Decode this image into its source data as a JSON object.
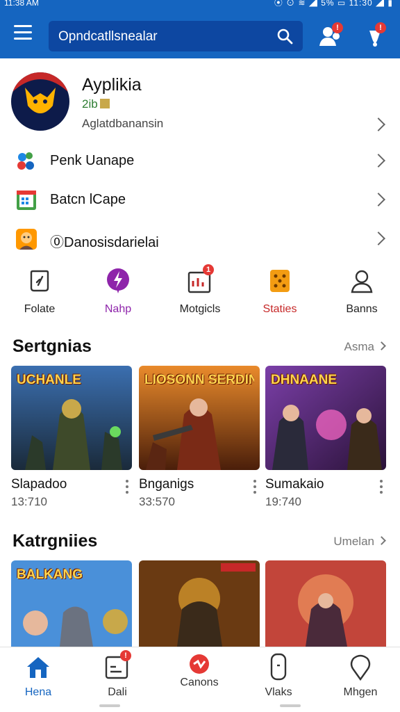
{
  "status_bar": {
    "left": "11:38 AM",
    "right": "⦿ ⊙ ≋ ◢ 5% ▭ 11:30 ◢ ▮"
  },
  "search": {
    "text": "Opndcatllsnealar"
  },
  "header_badges": {
    "friends": "!",
    "notifications": "!"
  },
  "profile": {
    "name": "Ayplikia",
    "level": "2ib",
    "subtitle": "Aglatdbanansin"
  },
  "menu_rows": [
    {
      "label": "Penk Uanape",
      "icon": "controller-icon"
    },
    {
      "label": "Batcn lCape",
      "icon": "calendar-icon"
    },
    {
      "label": "⓪Danosisdarielai",
      "icon": "character-icon"
    }
  ],
  "quick_actions": [
    {
      "label": "Folate",
      "icon": "shield-icon",
      "color": "#222222"
    },
    {
      "label": "Nahp",
      "icon": "lightning-icon",
      "color": "#8e24aa"
    },
    {
      "label": "Motgicls",
      "icon": "chart-icon",
      "color": "#222222",
      "badge": "1"
    },
    {
      "label": "Staties",
      "icon": "dice-icon",
      "color": "#c62828"
    },
    {
      "label": "Banns",
      "icon": "user-icon",
      "color": "#222222"
    }
  ],
  "section1": {
    "title": "Sertgnias",
    "more": "Asma",
    "cards": [
      {
        "art_title": "UCHANLE",
        "name": "Slapadoo",
        "count": "13:710"
      },
      {
        "art_title": "LIOSONN SERDIN",
        "name": "Bnganigs",
        "count": "33:570"
      },
      {
        "art_title": "DHNAANE",
        "name": "Sumakaio",
        "count": "19:740"
      }
    ]
  },
  "section2": {
    "title": "Katrgniies",
    "more": "Umelan",
    "cards": [
      {
        "art_title": "BALKANG"
      },
      {
        "art_title": ""
      },
      {
        "art_title": ""
      }
    ]
  },
  "bottom_nav": [
    {
      "label": "Hena",
      "icon": "home-icon",
      "active": true
    },
    {
      "label": "Dali",
      "icon": "tasks-icon",
      "badge": "!"
    },
    {
      "label": "Canons",
      "icon": "heart-icon"
    },
    {
      "label": "Vlaks",
      "icon": "phone-icon"
    },
    {
      "label": "Mhgen",
      "icon": "location-icon"
    }
  ],
  "colors": {
    "primary": "#1565c0",
    "primary_dark": "#0d47a1",
    "badge": "#e53935"
  }
}
